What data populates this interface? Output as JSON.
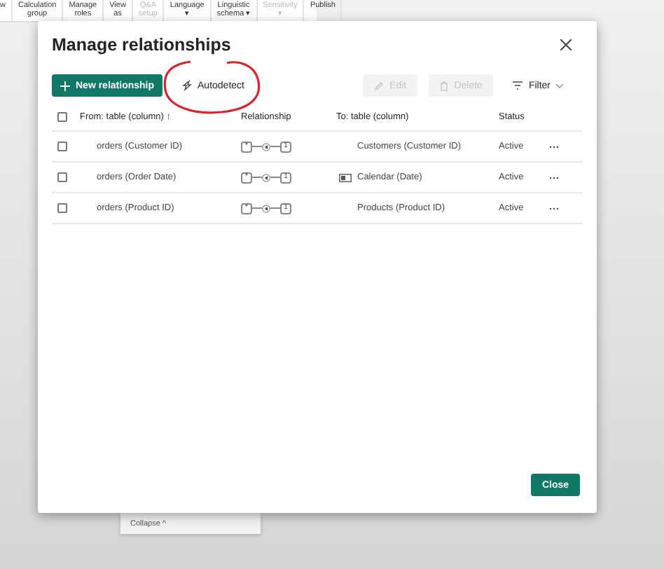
{
  "ribbon": {
    "items": [
      {
        "label": "w",
        "disabled": false
      },
      {
        "label": "Calculation",
        "sub": "group",
        "disabled": false
      },
      {
        "label": "Manage",
        "sub": "roles",
        "disabled": false
      },
      {
        "label": "View",
        "sub": "as",
        "disabled": false
      },
      {
        "label": "Q&A",
        "sub": "setup",
        "disabled": true
      },
      {
        "label": "Language",
        "sub": "▾",
        "disabled": false
      },
      {
        "label": "Linguistic",
        "sub": "schema ▾",
        "disabled": false
      },
      {
        "label": "Sensitivity",
        "sub": "▾",
        "disabled": true
      },
      {
        "label": "Publish",
        "disabled": false
      }
    ]
  },
  "dialog": {
    "title": "Manage relationships",
    "toolbar": {
      "new": "New relationship",
      "autodetect": "Autodetect",
      "edit": {
        "label": "Edit",
        "disabled": true
      },
      "delete": {
        "label": "Delete",
        "disabled": true
      },
      "filter": "Filter"
    },
    "table": {
      "select_all": {
        "checked": false
      },
      "columns": [
        "From: table (column)",
        "Relationship",
        "To: table (column)",
        "Status"
      ],
      "sort_mark": "↑",
      "rows": [
        {
          "checked": false,
          "from": "orders (Customer ID)",
          "from_card": "*",
          "to_card": "1",
          "date_table": false,
          "to": "Customers (Customer ID)",
          "status": "Active"
        },
        {
          "checked": false,
          "from": "orders (Order Date)",
          "from_card": "*",
          "to_card": "1",
          "date_table": true,
          "to": "Calendar (Date)",
          "status": "Active"
        },
        {
          "checked": false,
          "from": "orders (Product ID)",
          "from_card": "*",
          "to_card": "1",
          "date_table": false,
          "to": "Products (Product ID)",
          "status": "Active"
        }
      ]
    },
    "close_button": "Close"
  },
  "collapse": "Collapse ^"
}
